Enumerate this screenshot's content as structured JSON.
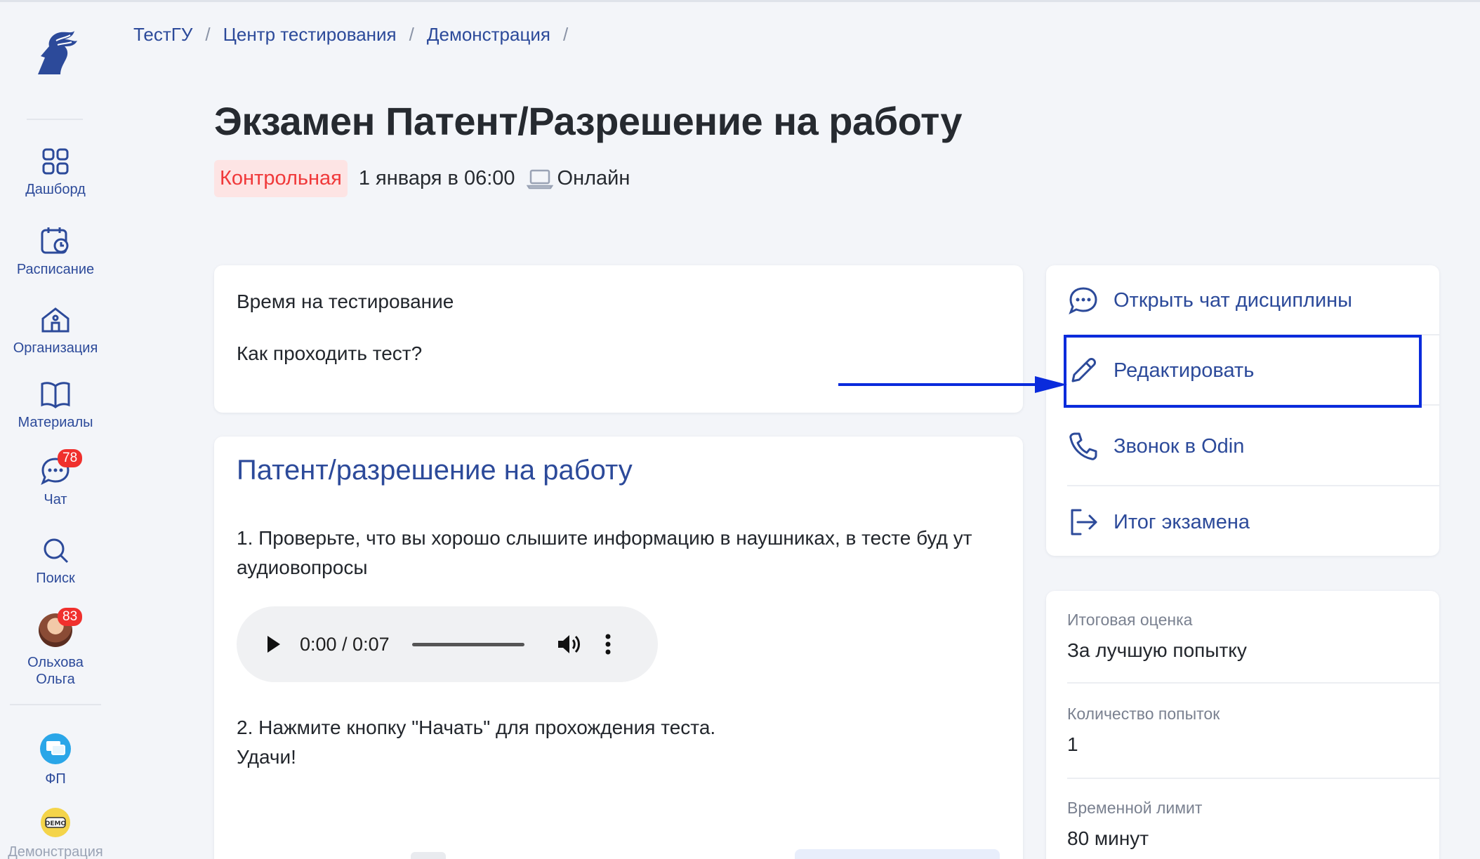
{
  "breadcrumb": [
    "ТестГУ",
    "Центр тестирования",
    "Демонстрация"
  ],
  "breadcrumb_sep": "/",
  "sidebar": {
    "items": [
      {
        "label": "Дашборд",
        "icon": "dashboard-icon"
      },
      {
        "label": "Расписание",
        "icon": "calendar-icon"
      },
      {
        "label": "Организация",
        "icon": "organization-icon"
      },
      {
        "label": "Материалы",
        "icon": "book-icon"
      },
      {
        "label": "Чат",
        "icon": "chat-icon",
        "badge": "78"
      },
      {
        "label": "Поиск",
        "icon": "search-icon"
      },
      {
        "label": "Ольхова Ольга",
        "icon": "avatar",
        "badge": "83"
      }
    ],
    "bottom": [
      {
        "label": "ФП",
        "icon": "fp-app-icon"
      },
      {
        "label": "Демонстрация",
        "icon": "demo-app-icon"
      }
    ]
  },
  "header": {
    "title": "Экзамен Патент/Разрешение на работу",
    "tag": "Контрольная",
    "date": "1 января в 06:00",
    "mode": "Онлайн"
  },
  "info": {
    "time_label": "Время на тестирование",
    "howto_label": "Как проходить тест?"
  },
  "main": {
    "heading": "Патент/разрешение на работу",
    "p1": "1. Проверьте, что вы хорошо слышите  информацию в наушниках, в тесте буд ут аудиовопросы",
    "audio_time": "0:00 / 0:07",
    "p2_line1": "2. Нажмите кнопку \"Начать\" для прохождения теста.",
    "p2_line2": "Удачи!"
  },
  "actions": [
    {
      "label": "Открыть чат дисциплины",
      "icon": "chat-bubble-icon"
    },
    {
      "label": "Редактировать",
      "icon": "pencil-icon"
    },
    {
      "label": "Звонок в Odin",
      "icon": "phone-icon"
    },
    {
      "label": "Итог экзамена",
      "icon": "exit-icon"
    }
  ],
  "stats": [
    {
      "label": "Итоговая оценка",
      "value": "За лучшую попытку"
    },
    {
      "label": "Количество попыток",
      "value": "1"
    },
    {
      "label": "Временной лимит",
      "value": "80 минут"
    }
  ],
  "colors": {
    "accent": "#2c4a9a",
    "tag_bg": "#fde4e4",
    "tag_text": "#f0393a",
    "badge": "#f0302d",
    "annotation": "#0a2bdc"
  }
}
